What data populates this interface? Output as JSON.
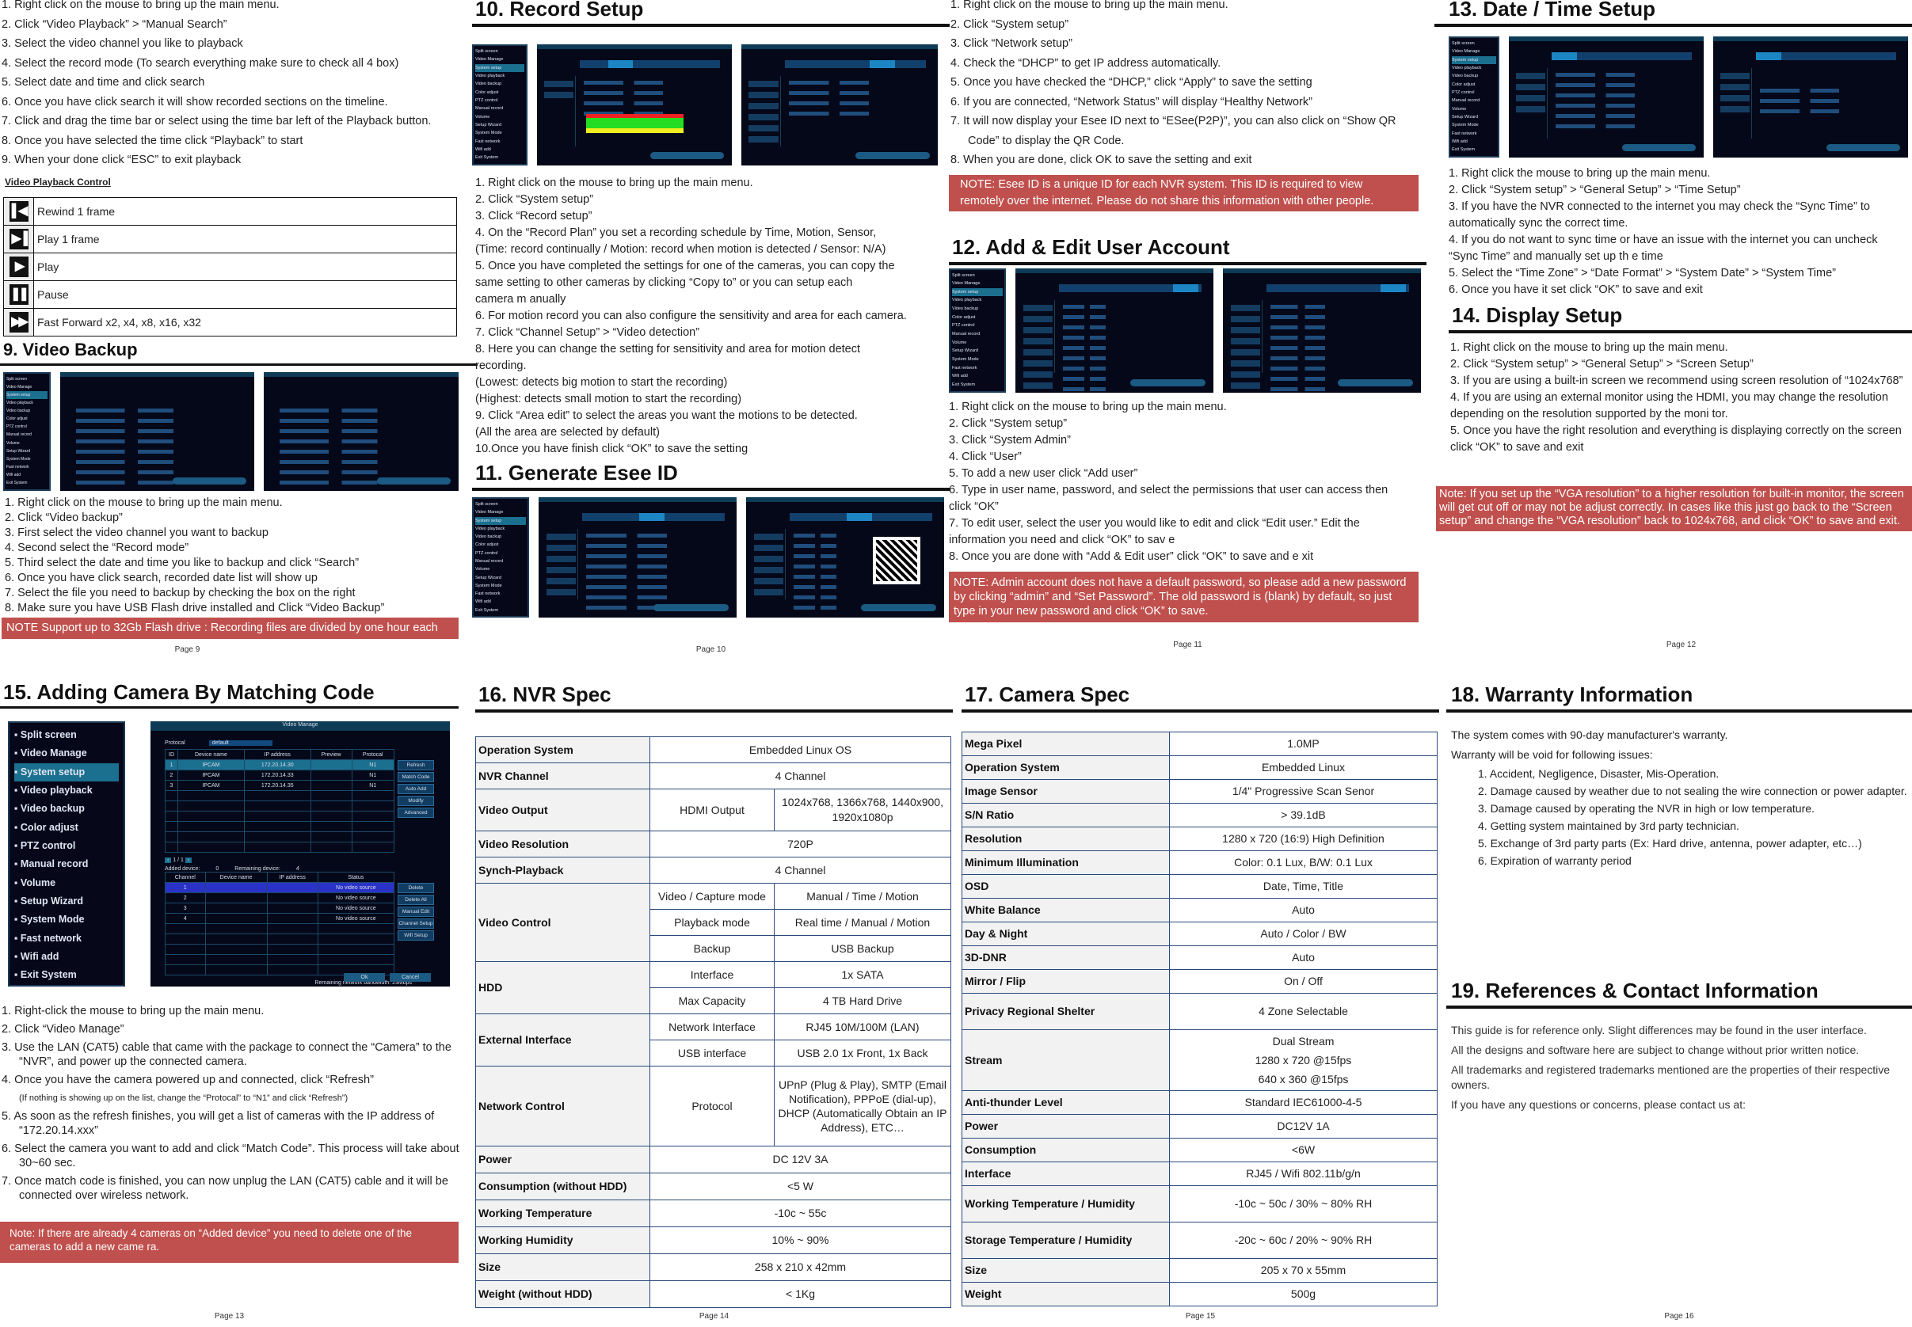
{
  "pages": {
    "p9": {
      "page_label": "Page 9",
      "playback_steps": [
        "1.  Right click on the mouse to bring up the main menu.",
        "2.  Click “Video Playback” > “Manual Search”",
        "3.  Select the video channel you like to playback",
        "4.  Select the record mode (To search everything make sure to check all 4 box)",
        "5.  Select date and time and click search",
        "6.  Once you have click search it will show recorded sections on the timeline.",
        "7.  Click and drag the time bar or select using the time bar left of the Playback button.",
        "8.  Once you have selected the time click “Playback” to start",
        "9.  When your done click “ESC” to exit playback"
      ],
      "vpc_title": "Video Playback Control",
      "vpc_rows": [
        {
          "icon": "rewind-frame-icon",
          "glyph": "▌◀",
          "label": "Rewind 1 frame"
        },
        {
          "icon": "play-frame-icon",
          "glyph": "▶▐",
          "label": "Play 1 frame"
        },
        {
          "icon": "play-icon",
          "glyph": "▶",
          "label": "Play"
        },
        {
          "icon": "pause-icon",
          "glyph": "❚❚",
          "label": "Pause"
        },
        {
          "icon": "fast-forward-icon",
          "glyph": "▶▶",
          "label": "Fast Forward x2, x4, x8, x16, x32"
        }
      ],
      "backup_title": "9. Video Backup",
      "backup_steps": [
        "1. Right click on the mouse to bring up the main menu.",
        "2. Click “Video backup”",
        "3. First select the video channel you want to backup",
        "4. Second select the “Record mode”",
        "5. Third select the date and time you like to backup and click “Search”",
        "6. Once you have click search, recorded date list will show up",
        "7. Select the file you need to backup by checking the box on the right",
        "8. Make sure you have USB Flash drive installed and Click “Video Backup”"
      ],
      "note": "NOTE   Support up to 32Gb Flash drive   : Recording files are divided by one hour each"
    },
    "p10": {
      "page_label": "Page 10",
      "record_title": "10. Record Setup",
      "record_steps": [
        "1. Right click on the mouse to bring up the main menu.",
        "2. Click “System setup”",
        "3. Click “Record setup”",
        "4. On the “Record Plan” you set a recording schedule by Time, Motion, Sensor,",
        "(Time: record continually / Motion: record when motion is detected / Sensor: N/A)",
        "5. Once you have completed the settings for one of the cameras, you can copy the",
        "same setting to other cameras by clicking “Copy to” or you can setup each",
        "camera m anually",
        "6. For motion record you can also configure the sensitivity and area for each camera.",
        "7. Click “Channel Setup” > “Video detection”",
        "8. Here you can change the setting for sensitivity and area for motion detect",
        "recording.",
        "(Lowest: detects big motion to start the recording)",
        "(Highest: detects small motion to start the recording)",
        "9. Click “Area edit” to select the areas you want the motions to be detected.",
        "(All the area are selected by default)",
        "10.Once you have finish click “OK” to save the setting"
      ],
      "esee_title": "11. Generate Esee ID"
    },
    "p11": {
      "page_label": "Page 11",
      "esee_steps": [
        "1.  Right click on the mouse to bring up the main menu.",
        "2.  Click “System setup”",
        "3.  Click “Network setup”",
        "4.  Check the “DHCP” to get IP address automatically.",
        "5.  Once you have checked the “DHCP,” click “Apply” to save the setting",
        "6.  If you are connected, “Network Status” will display “Healthy Network”",
        "7.  It will now display your Esee ID next to “ESee(P2P)”, you can also click on “Show QR Code” to display the QR Code.",
        "8.  When you are done, click OK to save the setting and exit"
      ],
      "esee_note": "NOTE: Esee ID is a unique ID for each NVR system. This ID is required to view remotely over the internet. Please do not share this information with other people.",
      "user_title": "12. Add & Edit User Account",
      "user_steps": [
        "1. Right click on the mouse to bring up the main menu.",
        "2. Click “System setup”",
        "3. Click “System Admin”",
        "4. Click “User”",
        "5. To add a new user click “Add user”",
        "6. Type in user name, password, and select the permissions that user can access then click “OK”",
        "7. To edit user, select the user you would like to edit and click “Edit user.” Edit the information you need and click “OK” to sav e",
        "8. Once you are done with “Add & Edit user” click “OK” to save and e xit"
      ],
      "user_note": "NOTE: Admin account does not have a default password, so please add a new password by clicking “admin” and “Set Password”. The old password is (blank) by default, so just type in your new password and click “OK” to save."
    },
    "p12": {
      "page_label": "Page 12",
      "date_title": "13. Date / Time Setup",
      "date_steps": [
        "1. Right click the mouse to bring up the main menu.",
        "2. Click “System setup” > “General Setup” > “Time Setup”",
        "3. If you have the NVR connected to the internet you may check the “Sync Time” to automatically sync the correct time.",
        "4. If you do not want to sync time or have an issue with the internet you can uncheck “Sync Time” and manually set up th e time",
        "5. Select the “Time Zone” > “Date Format” > “System Date” > “System Time”",
        "6. Once you have it set click “OK” to save and exit"
      ],
      "display_title": "14. Display Setup",
      "display_steps": [
        "1. Right click on the mouse to bring up the main menu.",
        "2. Click “System setup” > “General Setup” > “Screen Setup”",
        "3. If you are using a built-in screen we recommend using screen resolution of “1024x768”",
        "4. If you are using an external monitor using the HDMI, you may change the resolution depending on the resolution supported by the moni tor.",
        "5. Once you have the right resolution and everything is displaying correctly on the screen click “OK” to save and exit"
      ],
      "display_note": "Note: If you set up the “VGA resolution” to a higher resolution for built-in monitor, the screen will get cut off or may not be adjust correctly. In cases like this just go back to the “Screen setup” and change the “VGA resolution” back to 1024x768, and click “OK” to save and exit."
    },
    "p13": {
      "page_label": "Page 13",
      "title": "15. Adding Camera By Matching Code",
      "steps": [
        "1.  Right-click the mouse to bring up the main menu.",
        "2.  Click “Video Manage”",
        "3.  Use the LAN (CAT5) cable that came with the package to connect the “Camera” to the “NVR”, and power up the connected camera.",
        "4.  Once you have the camera powered up and connected, click “Refresh”",
        "(If nothing is showing up on the list, change the “Protocal” to “N1” and click “Refresh”)",
        "5.  As soon as the refresh finishes, you will get a list of cameras with the IP address of “172.20.14.xxx”",
        "6.  Select the camera you want to add and click “Match Code”. This process will take about 30~60 sec.",
        "7.  Once match code is finished, you can now unplug the LAN (CAT5) cable and it will be connected over wireless network."
      ],
      "note": "Note: If there are already 4 cameras on “Added device” you need to delete one of the cameras to add a new came ra.",
      "vm": {
        "title": "Video Manage",
        "protocol_label": "Protocal",
        "protocol_value": "default",
        "search_headers": [
          "ID",
          "Device name",
          "IP address",
          "Preview",
          "Protocal"
        ],
        "search_rows": [
          [
            "1",
            "IPCAM",
            "172.20.14.30",
            "",
            "N1"
          ],
          [
            "2",
            "IPCAM",
            "172.20.14.33",
            "",
            "N1"
          ],
          [
            "3",
            "IPCAM",
            "172.20.14.35",
            "",
            "N1"
          ]
        ],
        "right_buttons": [
          "Refresh",
          "Match Code",
          "Auto Add",
          "Modify",
          "Advanced"
        ],
        "pager": "1 / 1",
        "added_label": "Added device:",
        "added_value": "0",
        "remaining_label": "Remaining device:",
        "remaining_value": "4",
        "added_headers": [
          "Channel",
          "Device name",
          "IP address",
          "Status"
        ],
        "added_rows": [
          [
            "1",
            "",
            "",
            "No video source"
          ],
          [
            "2",
            "",
            "",
            "No video source"
          ],
          [
            "3",
            "",
            "",
            "No video source"
          ],
          [
            "4",
            "",
            "",
            "No video source"
          ]
        ],
        "added_buttons": [
          "Delete",
          "Delete All",
          "Manual Edit",
          "Channel Setup",
          "Wifi Setup"
        ],
        "bandwidth": "Remaining network bandwidth:  23Mbps",
        "ok": "Ok",
        "cancel": "Cancel"
      }
    },
    "p14": {
      "page_label": "Page 14",
      "title": "16. NVR Spec",
      "table": {
        "os_k": "Operation System",
        "os_v": "Embedded Linux OS",
        "ch_k": "NVR Channel",
        "ch_v": "4 Channel",
        "vo_k": "Video Output",
        "vo_sub": "HDMI Output",
        "vo_v": "1024x768, 1366x768, 1440x900, 1920x1080p",
        "vr_k": "Video Resolution",
        "vr_v": "720P",
        "sp_k": "Synch-Playback",
        "sp_v": "4 Channel",
        "vc_k": "Video Control",
        "vc1_sub": "Video / Capture mode",
        "vc1_v": "Manual / Time / Motion",
        "vc2_sub": "Playback mode",
        "vc2_v": "Real time / Manual / Motion",
        "vc3_sub": "Backup",
        "vc3_v": "USB Backup",
        "hdd_k": "HDD",
        "hdd1_sub": "Interface",
        "hdd1_v": "1x SATA",
        "hdd2_sub": "Max Capacity",
        "hdd2_v": "4 TB Hard Drive",
        "ei_k": "External Interface",
        "ei1_sub": "Network Interface",
        "ei1_v": "RJ45 10M/100M (LAN)",
        "ei2_sub": "USB interface",
        "ei2_v": "USB 2.0  1x Front, 1x Back",
        "nc_k": "Network Control",
        "nc_sub": "Protocol",
        "nc_v": "UPnP (Plug & Play), SMTP (Email Notification), PPPoE (dial-up), DHCP (Automatically Obtain an IP Address), ETC…",
        "pw_k": "Power",
        "pw_v": "DC 12V 3A",
        "cs_k": "Consumption (without HDD)",
        "cs_v": "<5 W",
        "wt_k": "Working Temperature",
        "wt_v": "-10c ~ 55c",
        "wh_k": "Working Humidity",
        "wh_v": "10% ~ 90%",
        "sz_k": "Size",
        "sz_v": "258 x 210 x 42mm",
        "wg_k": "Weight (without HDD)",
        "wg_v": "< 1Kg"
      }
    },
    "p15": {
      "page_label": "Page 15",
      "title": "17. Camera Spec",
      "rows": [
        [
          "Mega Pixel",
          "1.0MP"
        ],
        [
          "Operation System",
          "Embedded Linux"
        ],
        [
          "Image Sensor",
          "1/4\" Progressive Scan Senor"
        ],
        [
          "S/N Ratio",
          "> 39.1dB"
        ],
        [
          "Resolution",
          "1280 x 720 (16:9) High Definition"
        ],
        [
          "Minimum Illumination",
          "Color: 0.1 Lux, B/W: 0.1 Lux"
        ],
        [
          "OSD",
          "Date, Time, Title"
        ],
        [
          "White Balance",
          "Auto"
        ],
        [
          "Day & Night",
          "Auto / Color / BW"
        ],
        [
          "3D-DNR",
          "Auto"
        ],
        [
          "Mirror / Flip",
          "On / Off"
        ],
        [
          "Privacy Regional Shelter",
          "4 Zone Selectable"
        ],
        [
          "Stream",
          "Dual Stream|1280 x 720 @15fps|640 x 360 @15fps"
        ],
        [
          "Anti-thunder Level",
          "Standard IEC61000-4-5"
        ],
        [
          "Power",
          "DC12V 1A"
        ],
        [
          "Consumption",
          "<6W"
        ],
        [
          "Interface",
          "RJ45 / Wifi 802.11b/g/n"
        ],
        [
          "Working Temperature / Humidity",
          "-10c ~ 50c / 30% ~ 80% RH"
        ],
        [
          "Storage Temperature / Humidity",
          "-20c ~ 60c / 20% ~ 90% RH"
        ],
        [
          "Size",
          "205 x 70 x 55mm"
        ],
        [
          "Weight",
          "500g"
        ]
      ]
    },
    "p16": {
      "page_label": "Page 16",
      "warranty_title": "18. Warranty Information",
      "warranty_intro": "The system comes with 90-day manufacturer's warranty.",
      "warranty_void": "Warranty will be void for following issues:",
      "warranty_items": [
        "1. Accident, Negligence, Disaster, Mis-Operation.",
        "2. Damage caused by weather due to not sealing the wire connection or power adapter.",
        "3. Damage caused by operating the NVR in high or low temperature.",
        "4. Getting system maintained by 3rd party technician.",
        "5. Exchange of 3rd party parts (Ex: Hard drive, antenna, power adapter, etc…)",
        "6. Expiration of warranty period"
      ],
      "ref_title": "19. References & Contact Information",
      "ref_lines": [
        "This guide is for reference only. Slight differences may be found in the user interface.",
        "All the designs and software here are subject to change without prior written notice.",
        "All trademarks and registered trademarks mentioned are the properties of their respective owners.",
        "If you have any questions or concerns, please contact us at:"
      ]
    }
  },
  "nvr_menu": [
    "Split screen",
    "Video Manage",
    "System setup",
    "Video playback",
    "Video backup",
    "Color adjust",
    "PTZ control",
    "Manual record",
    "Volume",
    "Setup Wizard",
    "System Mode",
    "Fast network",
    "Wifi add",
    "Exit System"
  ],
  "colors": {
    "note_red": "#c0504d",
    "table_border": "#2a4a7b",
    "nvr_bg": "#050818",
    "nvr_accent": "#1b6f8f"
  }
}
